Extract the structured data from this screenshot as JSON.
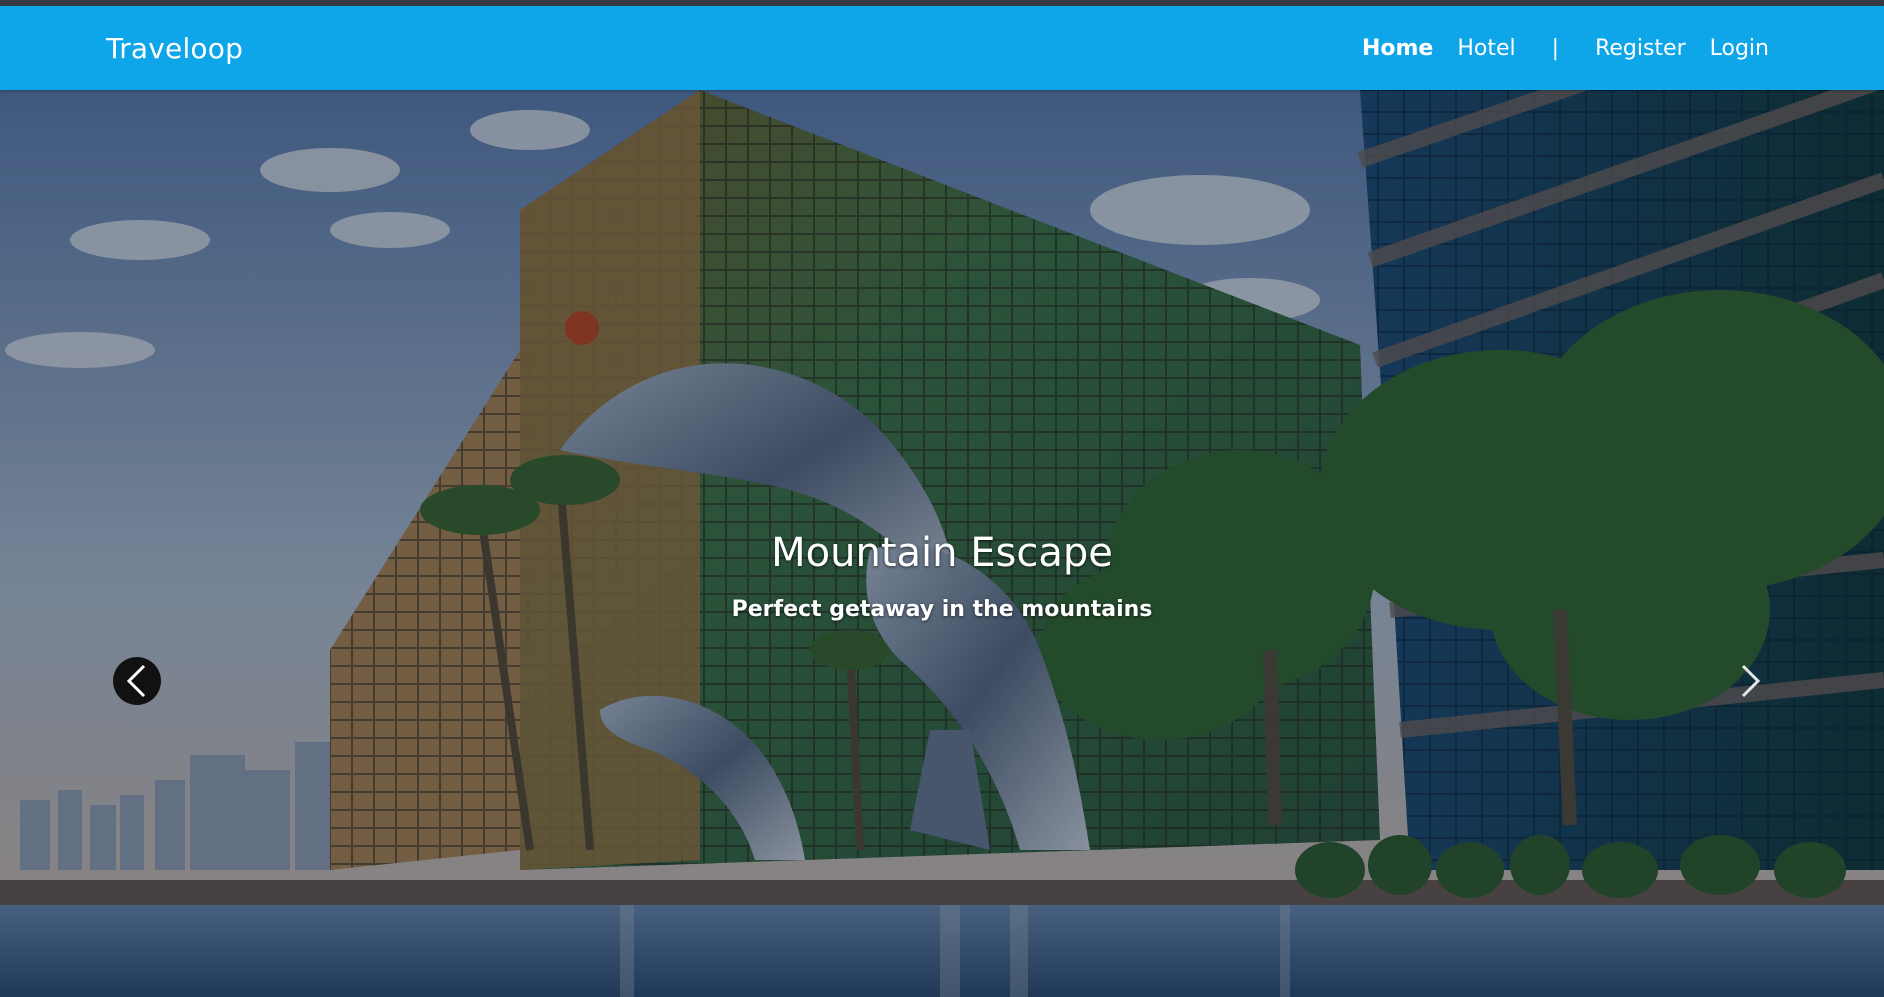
{
  "navbar": {
    "brand": "Traveloop",
    "links": {
      "home": "Home",
      "hotel": "Hotel",
      "separator": "|",
      "register": "Register",
      "login": "Login"
    }
  },
  "carousel": {
    "slide": {
      "title": "Mountain Escape",
      "subtitle": "Perfect getaway in the mountains"
    },
    "controls": {
      "prev_icon": "chevron-left-icon",
      "next_icon": "chevron-right-icon"
    }
  },
  "colors": {
    "navbar_bg": "#0ea5e9",
    "nav_text": "#ffffff"
  }
}
